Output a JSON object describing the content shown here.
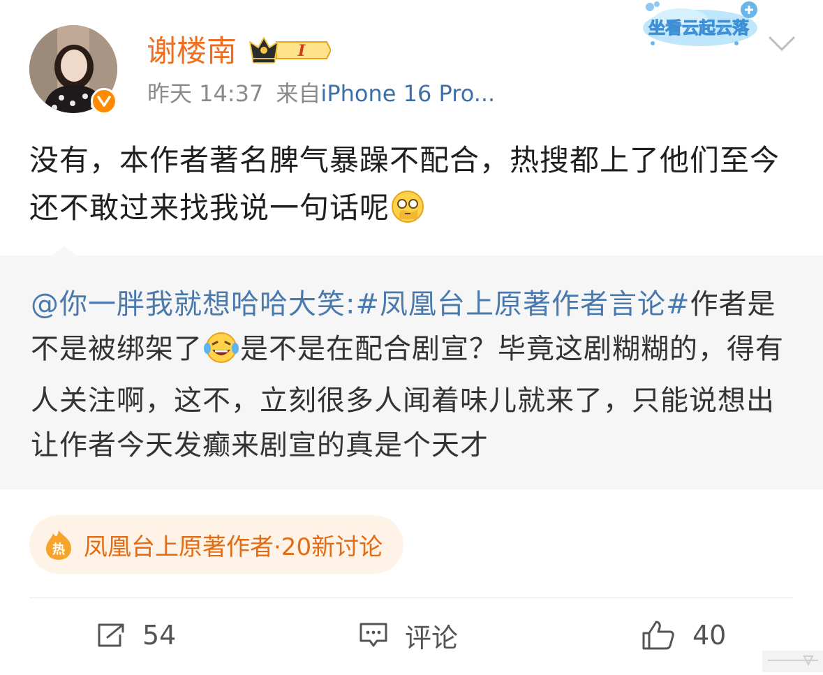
{
  "post": {
    "author": "谢楼南",
    "badge": "I",
    "time": "昨天 14:37",
    "source_prefix": "来自",
    "device": "iPhone 16 Pro...",
    "decoration_text": "坐看云起云落",
    "text": "没有，本作者著名脾气暴躁不配合，热搜都上了他们至今还不敢过来找我说一句话呢"
  },
  "quote": {
    "mention": "@你一胖我就想哈哈大笑",
    "colon": ":",
    "hashtag": "#凤凰台上原著作者言论#",
    "text_before_emoji": "作者是不是被绑架了",
    "text_after_emoji": "是不是在配合剧宣？毕竟这剧糊糊的，得有人关注啊，这不，立刻很多人闻着味儿就来了，只能说想出让作者今天发癫来剧宣的真是个天才"
  },
  "topic": {
    "icon_text": "热",
    "label": "凤凰台上原著作者",
    "count": "·20新讨论"
  },
  "actions": {
    "repost_count": "54",
    "comment_label": "评论",
    "like_count": "40"
  },
  "colors": {
    "username": "#f06e1f",
    "link": "#4a79ad",
    "topic": "#e36b13",
    "verified": "#ff8a00"
  }
}
